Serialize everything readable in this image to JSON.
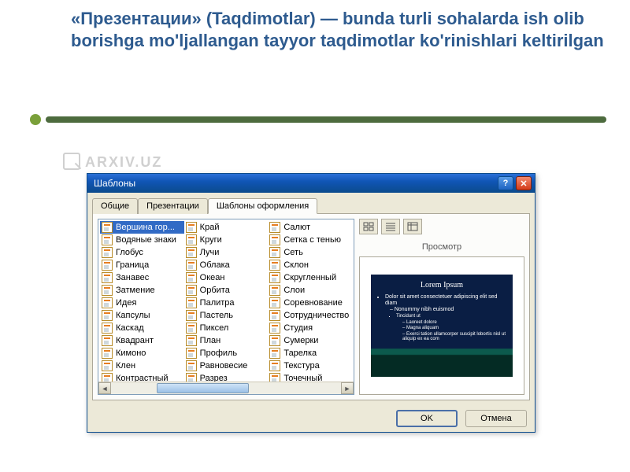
{
  "heading": "«Презентации» (Taqdimotlar) — bunda turli sohalarda ish olib borishga mo'ljallangan tayyor taqdimotlar ko'rinishlari keltirilgan",
  "watermark": "ARXIV.UZ",
  "dialog": {
    "title": "Шаблоны",
    "tabs": {
      "general": "Общие",
      "presentations": "Презентации",
      "designs": "Шаблоны оформления"
    },
    "preview_label": "Просмотр",
    "ok": "OK",
    "cancel": "Отмена",
    "col1": [
      "Вершина гор...",
      "Водяные знаки",
      "Глобус",
      "Граница",
      "Занавес",
      "Затмение",
      "Идея",
      "Капсулы",
      "Каскад",
      "Квадрант",
      "Кимоно",
      "Клен",
      "Контрастный"
    ],
    "col2": [
      "Край",
      "Круги",
      "Лучи",
      "Облака",
      "Океан",
      "Орбита",
      "Палитра",
      "Пастель",
      "Пиксел",
      "План",
      "Профиль",
      "Равновесие",
      "Разрез"
    ],
    "col3": [
      "Салют",
      "Сетка с тенью",
      "Сеть",
      "Склон",
      "Скругленный",
      "Слои",
      "Соревнование",
      "Сотрудничество",
      "Студия",
      "Сумерки",
      "Тарелка",
      "Текстура",
      "Точечный"
    ]
  },
  "slide": {
    "title": "Lorem Ipsum",
    "b1": "Dolor sit amet consectetuer adipiscing elit sed diam",
    "b2": "Nonummy nibh euismod",
    "b3": "Tincidunt ut",
    "b4a": "Laoreet dolore",
    "b4b": "Magna aliquam",
    "b5": "Exerci tation ullamcorper suscipit lobortis nisl ut aliquip ex ea com"
  }
}
